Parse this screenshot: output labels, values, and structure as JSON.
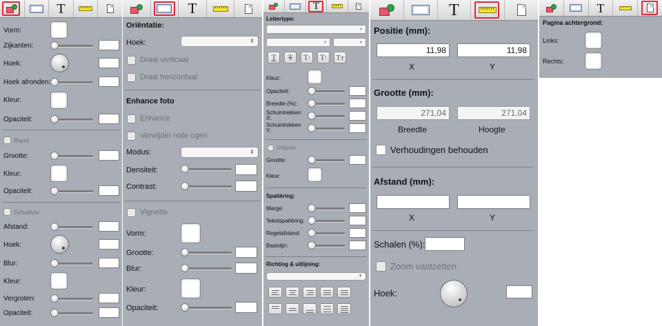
{
  "colors": {
    "panel_bg": "#a9adb5",
    "selected_tab_border": "#e0263a"
  },
  "tabs": {
    "icons": [
      "shapes-icon",
      "rectangle-icon",
      "text-icon",
      "ruler-icon",
      "page-icon"
    ]
  },
  "p1": {
    "vorm": "Vorm:",
    "zijkanten": "Zijkanten:",
    "hoek": "Hoek:",
    "hoek_afronden": "Hoek afronden:",
    "kleur": "Kleur:",
    "opaciteit": "Opaciteit:",
    "rand": "Rand",
    "rand_grootte": "Grootte:",
    "rand_kleur": "Kleur:",
    "rand_opaciteit": "Opaciteit:",
    "schaduw": "Schaduw",
    "afstand": "Afstand:",
    "sch_hoek": "Hoek:",
    "blur": "Blur:",
    "sch_kleur": "Kleur:",
    "vergroten": "Vergroten:",
    "sch_opaciteit": "Opaciteit:"
  },
  "p2": {
    "orientatie": "Oriëntatie:",
    "hoek": "Hoek:",
    "draai_verticaal": "Draai verticaal",
    "draai_horizontaal": "Draai horizontaal",
    "enhance_foto": "Enhance foto",
    "enhance": "Enhance",
    "rode_ogen": "Verwijder rode ogen",
    "modus": "Modus:",
    "densiteit": "Densiteit:",
    "contrast": "Contrast:",
    "vignette": "Vignette",
    "vorm": "Vorm:",
    "grootte": "Grootte:",
    "blur": "Blur:",
    "kleur": "Kleur:",
    "opaciteit": "Opaciteit:"
  },
  "p3": {
    "lettertype": "Lettertype:",
    "kleur": "Kleur:",
    "opaciteit": "Opaciteit:",
    "breedte": "Breedte (%):",
    "schuin_x": "Schuintrekken X:",
    "schuin_y": "Schuintrekken Y:",
    "uitlijnen": "Uitlijnen",
    "grootte": "Grootte:",
    "kleur2": "Kleur:",
    "spatiering": "Spatiëring:",
    "marge": "Marge:",
    "tekstspatiering": "Tekstspatiëring:",
    "regelafstand": "Regelafstand:",
    "basislijn": "Basislijn:",
    "richting": "Richting & uitlijning:"
  },
  "p4": {
    "positie": "Positie (mm):",
    "pos_x": "11,98",
    "pos_y": "11,98",
    "x": "X",
    "y": "Y",
    "grootte": "Grootte (mm):",
    "breedte_val": "271,04",
    "hoogte_val": "271,04",
    "breedte": "Breedte",
    "hoogte": "Hoogte",
    "verhoudingen": "Verhoudingen behouden",
    "afstand": "Afstand (mm):",
    "afst_x": "X",
    "afst_y": "Y",
    "schalen": "Schalen (%):",
    "zoom": "Zoom vastzetten",
    "hoek": "Hoek:"
  },
  "p5": {
    "pagina_achtergrond": "Pagina achtergrond:",
    "links": "Links:",
    "rechts": "Rechts:"
  }
}
